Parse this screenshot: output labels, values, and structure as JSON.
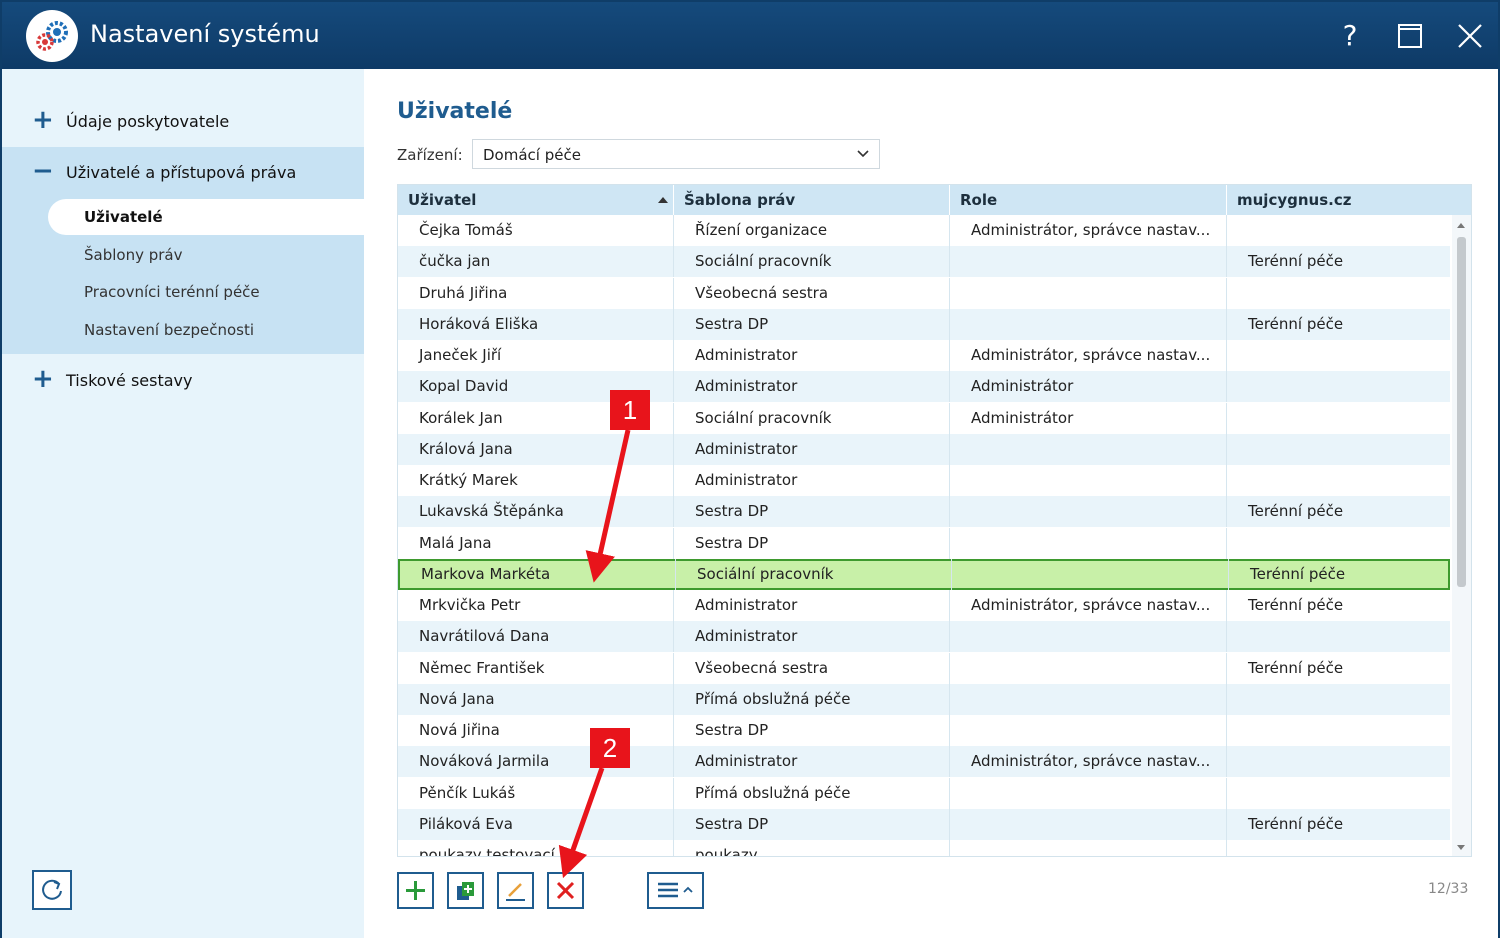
{
  "window": {
    "title": "Nastavení systému",
    "help_label": "?"
  },
  "sidebar": {
    "groups": [
      {
        "sign": "+",
        "label": "Údaje poskytovatele"
      },
      {
        "sign": "−",
        "label": "Uživatelé a přístupová práva"
      },
      {
        "sign": "+",
        "label": "Tiskové sestavy"
      }
    ],
    "subitems": [
      {
        "label": "Uživatelé",
        "active": true
      },
      {
        "label": "Šablony práv",
        "active": false
      },
      {
        "label": "Pracovníci terénní péče",
        "active": false
      },
      {
        "label": "Nastavení bezpečnosti",
        "active": false
      }
    ]
  },
  "main": {
    "title": "Uživatelé",
    "filter_label": "Zařízení:",
    "filter_value": "Domácí péče",
    "columns": [
      "Uživatel",
      "Šablona práv",
      "Role",
      "mujcygnus.cz"
    ],
    "rows": [
      [
        "Čejka Tomáš",
        "Řízení organizace",
        "Administrátor, správce nastav...",
        ""
      ],
      [
        "čučka jan",
        "Sociální pracovník",
        "",
        "Terénní péče"
      ],
      [
        "Druhá Jiřina",
        "Všeobecná sestra",
        "",
        ""
      ],
      [
        "Horáková Eliška",
        "Sestra DP",
        "",
        "Terénní péče"
      ],
      [
        "Janeček Jiří",
        "Administrator",
        "Administrátor, správce nastav...",
        ""
      ],
      [
        "Kopal David",
        "Administrator",
        "Administrátor",
        ""
      ],
      [
        "Korálek Jan",
        "Sociální pracovník",
        "Administrátor",
        ""
      ],
      [
        "Králová Jana",
        "Administrator",
        "",
        ""
      ],
      [
        "Krátký Marek",
        "Administrator",
        "",
        ""
      ],
      [
        "Lukavská Štěpánka",
        "Sestra DP",
        "",
        "Terénní péče"
      ],
      [
        "Malá Jana",
        "Sestra DP",
        "",
        ""
      ],
      [
        "Markova Markéta",
        "Sociální pracovník",
        "",
        "Terénní péče"
      ],
      [
        "Mrkvička Petr",
        "Administrator",
        "Administrátor, správce nastav...",
        "Terénní péče"
      ],
      [
        "Navrátilová Dana",
        "Administrator",
        "",
        ""
      ],
      [
        "Němec František",
        "Všeobecná sestra",
        "",
        "Terénní péče"
      ],
      [
        "Nová Jana",
        "Přímá obslužná péče",
        "",
        ""
      ],
      [
        "Nová Jiřina",
        "Sestra DP",
        "",
        ""
      ],
      [
        "Nováková Jarmila",
        "Administrator",
        "Administrátor, správce nastav...",
        ""
      ],
      [
        "Pěnčík Lukáš",
        "Přímá obslužná péče",
        "",
        ""
      ],
      [
        "Piláková Eva",
        "Sestra DP",
        "",
        "Terénní péče"
      ],
      [
        "poukazy testovací",
        "poukazy",
        "",
        ""
      ]
    ],
    "selected_row": 11,
    "counter": "12/33"
  },
  "toolbar": {
    "icons": [
      "add-icon",
      "copy-add-icon",
      "edit-icon",
      "delete-icon",
      "menu-icon"
    ]
  },
  "annotations": {
    "callout_1": "1",
    "callout_2": "2"
  },
  "colors": {
    "titlebar": "#0e3a66",
    "accent": "#1f5c8f",
    "sidebar_bg": "#e7f4fb",
    "selected_row": "#c8f0a8",
    "callout": "#e8141b"
  }
}
